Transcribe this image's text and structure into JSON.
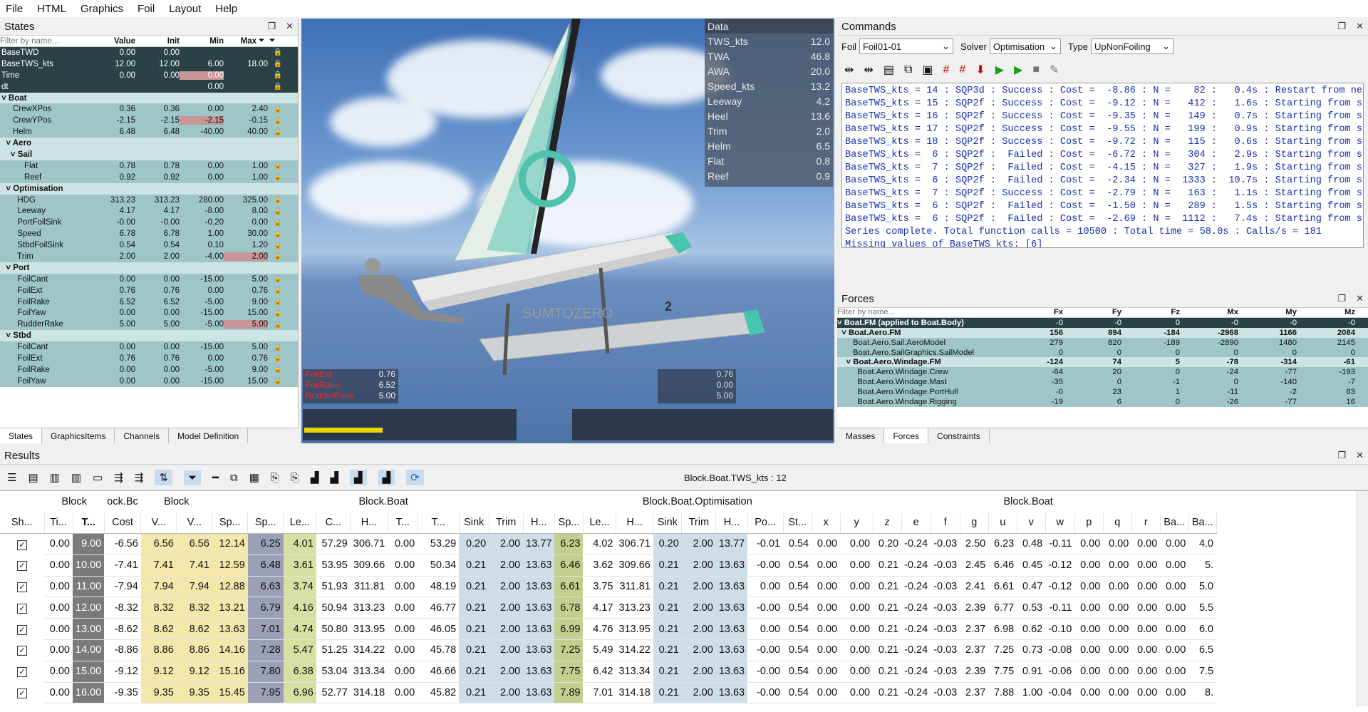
{
  "menu": [
    "File",
    "HTML",
    "Graphics",
    "Foil",
    "Layout",
    "Help"
  ],
  "states": {
    "title": "States",
    "filter_placeholder": "Filter by name...",
    "headers": [
      "Value",
      "Init",
      "Min",
      "Max"
    ],
    "rows": [
      {
        "name": "BaseTWD",
        "v": "0.00",
        "i": "0.00",
        "mn": "",
        "mx": "",
        "k": "dark"
      },
      {
        "name": "BaseTWS_kts",
        "v": "12.00",
        "i": "12.00",
        "mn": "6.00",
        "mx": "18.00",
        "k": "dark"
      },
      {
        "name": "Time",
        "v": "0.00",
        "i": "0.00",
        "mn": "0.00",
        "mx": "",
        "k": "dark",
        "r": "mn"
      },
      {
        "name": "dt",
        "v": "",
        "i": "",
        "mn": "0.00",
        "mx": "",
        "k": "dark"
      },
      {
        "name": "˅ Boat",
        "v": "",
        "i": "",
        "mn": "",
        "mx": "",
        "k": "grp"
      },
      {
        "name": "     CrewXPos",
        "v": "0.36",
        "i": "0.36",
        "mn": "0.00",
        "mx": "2.40",
        "k": "item"
      },
      {
        "name": "     CrewYPos",
        "v": "-2.15",
        "i": "-2.15",
        "mn": "-2.15",
        "mx": "-0.15",
        "k": "item",
        "r": "mn"
      },
      {
        "name": "     Helm",
        "v": "6.48",
        "i": "6.48",
        "mn": "-40.00",
        "mx": "40.00",
        "k": "item"
      },
      {
        "name": "  ˅ Aero",
        "v": "",
        "i": "",
        "mn": "",
        "mx": "",
        "k": "grp"
      },
      {
        "name": "    ˅ Sail",
        "v": "",
        "i": "",
        "mn": "",
        "mx": "",
        "k": "grp"
      },
      {
        "name": "          Flat",
        "v": "0.78",
        "i": "0.78",
        "mn": "0.00",
        "mx": "1.00",
        "k": "item"
      },
      {
        "name": "          Reef",
        "v": "0.92",
        "i": "0.92",
        "mn": "0.00",
        "mx": "1.00",
        "k": "item"
      },
      {
        "name": "  ˅ Optimisation",
        "v": "",
        "i": "",
        "mn": "",
        "mx": "",
        "k": "grp"
      },
      {
        "name": "       HDG",
        "v": "313.23",
        "i": "313.23",
        "mn": "280.00",
        "mx": "325.00",
        "k": "item"
      },
      {
        "name": "       Leeway",
        "v": "4.17",
        "i": "4.17",
        "mn": "-8.00",
        "mx": "8.00",
        "k": "item"
      },
      {
        "name": "       PortFoilSink",
        "v": "-0.00",
        "i": "-0.00",
        "mn": "-0.20",
        "mx": "0.00",
        "k": "item"
      },
      {
        "name": "       Speed",
        "v": "6.78",
        "i": "6.78",
        "mn": "1.00",
        "mx": "30.00",
        "k": "item"
      },
      {
        "name": "       StbdFoilSink",
        "v": "0.54",
        "i": "0.54",
        "mn": "0.10",
        "mx": "1.20",
        "k": "item"
      },
      {
        "name": "       Trim",
        "v": "2.00",
        "i": "2.00",
        "mn": "-4.00",
        "mx": "2.00",
        "k": "item",
        "r": "mx"
      },
      {
        "name": "  ˅ Port",
        "v": "",
        "i": "",
        "mn": "",
        "mx": "",
        "k": "grp"
      },
      {
        "name": "       FoilCant",
        "v": "0.00",
        "i": "0.00",
        "mn": "-15.00",
        "mx": "5.00",
        "k": "item"
      },
      {
        "name": "       FoilExt",
        "v": "0.76",
        "i": "0.76",
        "mn": "0.00",
        "mx": "0.76",
        "k": "item"
      },
      {
        "name": "       FoilRake",
        "v": "6.52",
        "i": "6.52",
        "mn": "-5.00",
        "mx": "9.00",
        "k": "item"
      },
      {
        "name": "       FoilYaw",
        "v": "0.00",
        "i": "0.00",
        "mn": "-15.00",
        "mx": "15.00",
        "k": "item"
      },
      {
        "name": "       RudderRake",
        "v": "5.00",
        "i": "5.00",
        "mn": "-5.00",
        "mx": "5.00",
        "k": "item",
        "r": "mx"
      },
      {
        "name": "  ˅ Stbd",
        "v": "",
        "i": "",
        "mn": "",
        "mx": "",
        "k": "grp"
      },
      {
        "name": "       FoilCant",
        "v": "0.00",
        "i": "0.00",
        "mn": "-15.00",
        "mx": "5.00",
        "k": "item"
      },
      {
        "name": "       FoilExt",
        "v": "0.76",
        "i": "0.76",
        "mn": "0.00",
        "mx": "0.76",
        "k": "item"
      },
      {
        "name": "       FoilRake",
        "v": "0.00",
        "i": "0.00",
        "mn": "-5.00",
        "mx": "9.00",
        "k": "item"
      },
      {
        "name": "       FoilYaw",
        "v": "0.00",
        "i": "0.00",
        "mn": "-15.00",
        "mx": "15.00",
        "k": "item"
      }
    ],
    "tabs": [
      "States",
      "GraphicsItems",
      "Channels",
      "Model Definition"
    ]
  },
  "view": {
    "data_title": "Data",
    "data": [
      [
        "TWS_kts",
        "12.0"
      ],
      [
        "TWA",
        "46.8"
      ],
      [
        "AWA",
        "20.0"
      ],
      [
        "Speed_kts",
        "13.2"
      ],
      [
        "Leeway",
        "4.2"
      ],
      [
        "Heel",
        "13.6"
      ],
      [
        "Trim",
        "2.0"
      ],
      [
        "Helm",
        "6.5"
      ],
      [
        "Flat",
        "0.8"
      ],
      [
        "Reef",
        "0.9"
      ]
    ],
    "port": [
      [
        "FoilExt",
        "0.76"
      ],
      [
        "FoilRake",
        "6.52"
      ],
      [
        "RudderRake",
        "5.00"
      ]
    ],
    "stbd": [
      "0.76",
      "0.00",
      "5.00"
    ],
    "boat_brand": "SUMTOZERO",
    "boat_num": "2"
  },
  "commands": {
    "title": "Commands",
    "foil_label": "Foil",
    "foil_value": "Foil01-01",
    "solver_label": "Solver",
    "solver_value": "Optimisation",
    "type_label": "Type",
    "type_value": "UpNonFoiling",
    "log": [
      "BaseTWS_kts = 14 : SQP3d : Success : Cost =  -8.86 : N =    82 :   0.4s : Restart from ne",
      "BaseTWS_kts = 15 : SQP2f : Success : Cost =  -9.12 : N =   412 :   1.6s : Starting from s",
      "BaseTWS_kts = 16 : SQP2f : Success : Cost =  -9.35 : N =   149 :   0.7s : Starting from s",
      "BaseTWS_kts = 17 : SQP2f : Success : Cost =  -9.55 : N =   199 :   0.9s : Starting from s",
      "BaseTWS_kts = 18 : SQP2f : Success : Cost =  -9.72 : N =   115 :   0.6s : Starting from s",
      "BaseTWS_kts =  6 : SQP2f :  Failed : Cost =  -6.72 : N =   304 :   2.9s : Starting from s",
      "BaseTWS_kts =  7 : SQP2f :  Failed : Cost =  -4.15 : N =   327 :   1.9s : Starting from s",
      "BaseTWS_kts =  6 : SQP2f :  Failed : Cost =  -2.34 : N =  1333 :  10.7s : Starting from s",
      "BaseTWS_kts =  7 : SQP2f : Success : Cost =  -2.79 : N =   163 :   1.1s : Starting from s",
      "BaseTWS_kts =  6 : SQP2f :  Failed : Cost =  -1.50 : N =   289 :   1.5s : Starting from s",
      "BaseTWS_kts =  6 : SQP2f :  Failed : Cost =  -2.69 : N =  1112 :   7.4s : Starting from s",
      "Series complete. Total function calls = 10500 : Total time = 58.0s : Calls/s = 181",
      "Missing values of BaseTWS_kts: [6]"
    ]
  },
  "forces": {
    "title": "Forces",
    "filter_placeholder": "Filter by name...",
    "headers": [
      "Fx",
      "Fy",
      "Fz",
      "Mx",
      "My",
      "Mz"
    ],
    "rows": [
      {
        "name": "˅ Boat.FM (applied to Boat.Body)",
        "c": [
          "-0",
          "-0",
          "0",
          "-0",
          "-0",
          "-0"
        ],
        "k": "dark"
      },
      {
        "name": "  ˅ Boat.Aero.FM",
        "c": [
          "156",
          "894",
          "-184",
          "-2968",
          "1166",
          "2084"
        ],
        "k": "grp"
      },
      {
        "name": "       Boat.Aero.Sail.AeroModel",
        "c": [
          "279",
          "820",
          "-189",
          "-2890",
          "1480",
          "2145"
        ],
        "k": "item"
      },
      {
        "name": "       Boat.Aero.SailGraphics.SailModel",
        "c": [
          "0",
          "0",
          "0",
          "0",
          "0",
          "0"
        ],
        "k": "item"
      },
      {
        "name": "    ˅ Boat.Aero.Windage.FM",
        "c": [
          "-124",
          "74",
          "5",
          "-78",
          "-314",
          "-61"
        ],
        "k": "grp"
      },
      {
        "name": "         Boat.Aero.Windage.Crew",
        "c": [
          "-64",
          "20",
          "0",
          "-24",
          "-77",
          "-193"
        ],
        "k": "item"
      },
      {
        "name": "         Boat.Aero.Windage.Mast",
        "c": [
          "-35",
          "0",
          "-1",
          "0",
          "-140",
          "-7"
        ],
        "k": "item"
      },
      {
        "name": "         Boat.Aero.Windage.PortHull",
        "c": [
          "-0",
          "23",
          "1",
          "-11",
          "-2",
          "63"
        ],
        "k": "item"
      },
      {
        "name": "         Boat.Aero.Windage.Rigging",
        "c": [
          "-19",
          "6",
          "0",
          "-26",
          "-77",
          "16"
        ],
        "k": "item"
      }
    ],
    "tabs": [
      "Masses",
      "Forces",
      "Constraints"
    ]
  },
  "results": {
    "title": "Results",
    "tag": "Block.Boat.TWS_kts : 12",
    "groups": [
      "Block",
      "ock.Bc",
      "Block",
      "Block.Boat",
      "Block.Boat.Optimisation",
      "Block.Boat"
    ],
    "cols": [
      "Sh...",
      "Ti...",
      "T...",
      "Cost",
      "V...",
      "V...",
      "Sp...",
      "Sp...",
      "Le...",
      "C...",
      "H...",
      "T...",
      "T...",
      "Sink",
      "Trim",
      "H...",
      "Sp...",
      "Le...",
      "H...",
      "Sink",
      "Trim",
      "H...",
      "Po...",
      "St...",
      "x",
      "y",
      "z",
      "e",
      "f",
      "g",
      "u",
      "v",
      "w",
      "p",
      "q",
      "r",
      "Ba...",
      "Ba..."
    ],
    "rows": [
      [
        "0.00",
        "9.00",
        "-6.56",
        "6.56",
        "6.56",
        "12.14",
        "6.25",
        "4.01",
        "57.29",
        "306.71",
        "0.00",
        "53.29",
        "0.20",
        "2.00",
        "13.77",
        "6.23",
        "4.02",
        "306.71",
        "0.20",
        "2.00",
        "13.77",
        "-0.01",
        "0.54",
        "0.00",
        "0.00",
        "0.20",
        "-0.24",
        "-0.03",
        "2.50",
        "6.23",
        "0.48",
        "-0.11",
        "0.00",
        "0.00",
        "0.00",
        "0.00",
        "4.0"
      ],
      [
        "0.00",
        "10.00",
        "-7.41",
        "7.41",
        "7.41",
        "12.59",
        "6.48",
        "3.61",
        "53.95",
        "309.66",
        "0.00",
        "50.34",
        "0.21",
        "2.00",
        "13.63",
        "6.46",
        "3.62",
        "309.66",
        "0.21",
        "2.00",
        "13.63",
        "-0.00",
        "0.54",
        "0.00",
        "0.00",
        "0.21",
        "-0.24",
        "-0.03",
        "2.45",
        "6.46",
        "0.45",
        "-0.12",
        "0.00",
        "0.00",
        "0.00",
        "0.00",
        "5."
      ],
      [
        "0.00",
        "11.00",
        "-7.94",
        "7.94",
        "7.94",
        "12.88",
        "6.63",
        "3.74",
        "51.93",
        "311.81",
        "0.00",
        "48.19",
        "0.21",
        "2.00",
        "13.63",
        "6.61",
        "3.75",
        "311.81",
        "0.21",
        "2.00",
        "13.63",
        "0.00",
        "0.54",
        "0.00",
        "0.00",
        "0.21",
        "-0.24",
        "-0.03",
        "2.41",
        "6.61",
        "0.47",
        "-0.12",
        "0.00",
        "0.00",
        "0.00",
        "0.00",
        "5.0"
      ],
      [
        "0.00",
        "12.00",
        "-8.32",
        "8.32",
        "8.32",
        "13.21",
        "6.79",
        "4.16",
        "50.94",
        "313.23",
        "0.00",
        "46.77",
        "0.21",
        "2.00",
        "13.63",
        "6.78",
        "4.17",
        "313.23",
        "0.21",
        "2.00",
        "13.63",
        "-0.00",
        "0.54",
        "0.00",
        "0.00",
        "0.21",
        "-0.24",
        "-0.03",
        "2.39",
        "6.77",
        "0.53",
        "-0.11",
        "0.00",
        "0.00",
        "0.00",
        "0.00",
        "5.5"
      ],
      [
        "0.00",
        "13.00",
        "-8.62",
        "8.62",
        "8.62",
        "13.63",
        "7.01",
        "4.74",
        "50.80",
        "313.95",
        "0.00",
        "46.05",
        "0.21",
        "2.00",
        "13.63",
        "6.99",
        "4.76",
        "313.95",
        "0.21",
        "2.00",
        "13.63",
        "0.00",
        "0.54",
        "0.00",
        "0.00",
        "0.21",
        "-0.24",
        "-0.03",
        "2.37",
        "6.98",
        "0.62",
        "-0.10",
        "0.00",
        "0.00",
        "0.00",
        "0.00",
        "6.0"
      ],
      [
        "0.00",
        "14.00",
        "-8.86",
        "8.86",
        "8.86",
        "14.16",
        "7.28",
        "5.47",
        "51.25",
        "314.22",
        "0.00",
        "45.78",
        "0.21",
        "2.00",
        "13.63",
        "7.25",
        "5.49",
        "314.22",
        "0.21",
        "2.00",
        "13.63",
        "-0.00",
        "0.54",
        "0.00",
        "0.00",
        "0.21",
        "-0.24",
        "-0.03",
        "2.37",
        "7.25",
        "0.73",
        "-0.08",
        "0.00",
        "0.00",
        "0.00",
        "0.00",
        "6.5"
      ],
      [
        "0.00",
        "15.00",
        "-9.12",
        "9.12",
        "9.12",
        "15.16",
        "7.80",
        "6.38",
        "53.04",
        "313.34",
        "0.00",
        "46.66",
        "0.21",
        "2.00",
        "13.63",
        "7.75",
        "6.42",
        "313.34",
        "0.21",
        "2.00",
        "13.63",
        "-0.00",
        "0.54",
        "0.00",
        "0.00",
        "0.21",
        "-0.24",
        "-0.03",
        "2.39",
        "7.75",
        "0.91",
        "-0.06",
        "0.00",
        "0.00",
        "0.00",
        "0.00",
        "7.5"
      ],
      [
        "0.00",
        "16.00",
        "-9.35",
        "9.35",
        "9.35",
        "15.45",
        "7.95",
        "6.96",
        "52.77",
        "314.18",
        "0.00",
        "45.82",
        "0.21",
        "2.00",
        "13.63",
        "7.89",
        "7.01",
        "314.18",
        "0.21",
        "2.00",
        "13.63",
        "-0.00",
        "0.54",
        "0.00",
        "0.00",
        "0.21",
        "-0.24",
        "-0.03",
        "2.37",
        "7.88",
        "1.00",
        "-0.04",
        "0.00",
        "0.00",
        "0.00",
        "0.00",
        "8."
      ]
    ]
  }
}
